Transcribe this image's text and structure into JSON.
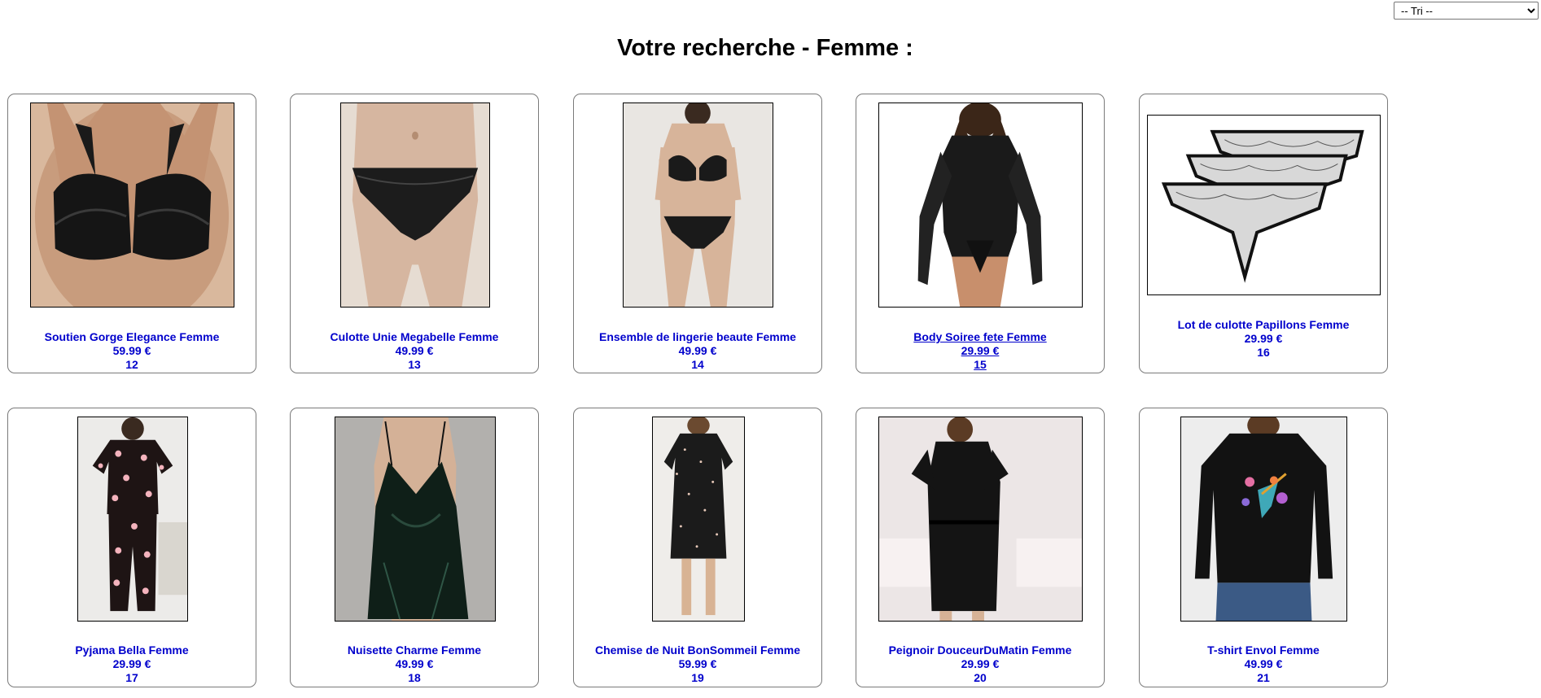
{
  "sort": {
    "selected": "-- Tri --",
    "options": [
      "-- Tri --"
    ]
  },
  "page": {
    "title": "Votre recherche - Femme :"
  },
  "products": [
    {
      "name": "Soutien Gorge Elegance Femme",
      "price": "59.99 €",
      "id": "12",
      "image": "black-lace-bra-photo"
    },
    {
      "name": "Culotte Unie Megabelle Femme",
      "price": "49.99 €",
      "id": "13",
      "image": "black-lace-panty-photo"
    },
    {
      "name": "Ensemble de lingerie beaute Femme",
      "price": "49.99 €",
      "id": "14",
      "image": "black-lingerie-set-photo"
    },
    {
      "name": "Body Soiree fete Femme",
      "price": "29.99 €",
      "id": "15",
      "image": "black-mesh-bodysuit-photo"
    },
    {
      "name": "Lot de culotte Papillons Femme",
      "price": "29.99 €",
      "id": "16",
      "image": "lace-panties-pack-photo"
    },
    {
      "name": "Pyjama Bella Femme",
      "price": "29.99 €",
      "id": "17",
      "image": "heart-print-pyjama-photo"
    },
    {
      "name": "Nuisette Charme Femme",
      "price": "49.99 €",
      "id": "18",
      "image": "green-satin-nightie-photo"
    },
    {
      "name": "Chemise de Nuit BonSommeil Femme",
      "price": "59.99 €",
      "id": "19",
      "image": "floral-nightshirt-photo"
    },
    {
      "name": "Peignoir DouceurDuMatin Femme",
      "price": "29.99 €",
      "id": "20",
      "image": "black-robe-photo"
    },
    {
      "name": "T-shirt Envol Femme",
      "price": "49.99 €",
      "id": "21",
      "image": "hummingbird-tshirt-photo"
    }
  ],
  "colors": {
    "link": "#0000cc",
    "card_border": "#7a7a7a"
  }
}
